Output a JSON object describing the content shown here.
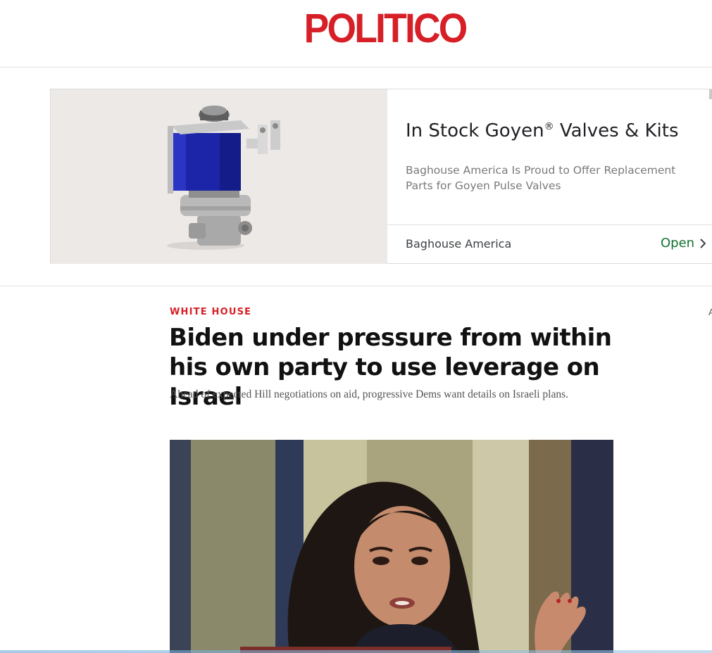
{
  "masthead": {
    "logo_text": "POLITICO"
  },
  "ad": {
    "headline_main": "In Stock Goyen",
    "headline_mark": "®",
    "headline_rest": " Valves & Kits",
    "description": "Baghouse America Is Proud to Offer Replacement Parts for Goyen Pulse Valves",
    "advertiser": "Baghouse America",
    "cta_label": "Open",
    "image_subject": "solenoid-valve-image"
  },
  "article": {
    "kicker": "WHITE HOUSE",
    "headline": "Biden under pressure from within his own party to use leverage on Israel",
    "dek": "Ahead of expected Hill negotiations on aid, progressive Dems want details on Israeli plans.",
    "hero_image": "photo-woman-speaking-at-hearing"
  },
  "edge": {
    "right_glyph": "A"
  },
  "colors": {
    "brand_red": "#d61f26",
    "cta_green": "#137333",
    "ad_bg": "#ece9e7"
  }
}
